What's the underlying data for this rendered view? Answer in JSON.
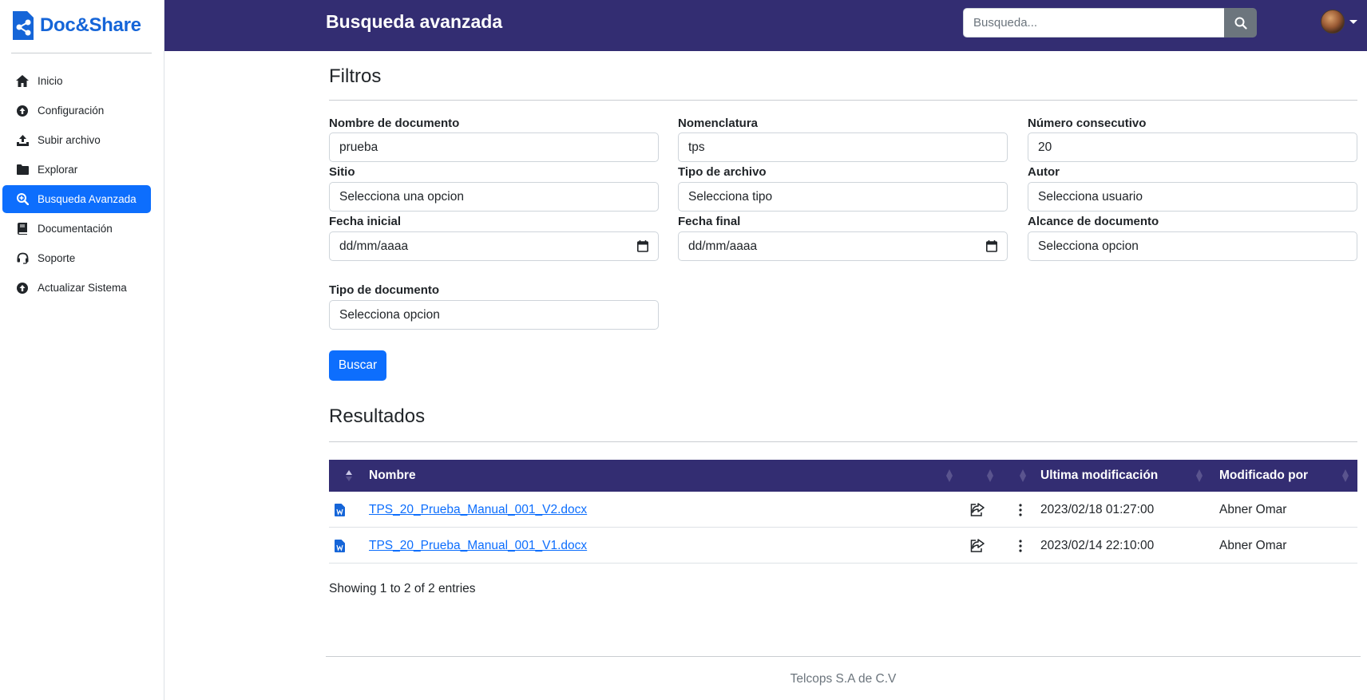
{
  "app": {
    "brand": "Doc&Share",
    "page_title": "Busqueda avanzada",
    "brand_color": "#1565d8",
    "header_color": "#332d72",
    "accent": "#0d6efd"
  },
  "search": {
    "placeholder": "Busqueda..."
  },
  "sidebar": {
    "items": [
      {
        "label": "Inicio",
        "icon": "home-icon"
      },
      {
        "label": "Configuración",
        "icon": "circle-arrow-up-icon"
      },
      {
        "label": "Subir archivo",
        "icon": "upload-icon"
      },
      {
        "label": "Explorar",
        "icon": "folder-icon"
      },
      {
        "label": "Busqueda Avanzada",
        "icon": "search-plus-icon",
        "active": true
      },
      {
        "label": "Documentación",
        "icon": "book-icon"
      },
      {
        "label": "Soporte",
        "icon": "headset-icon"
      },
      {
        "label": "Actualizar Sistema",
        "icon": "circle-arrow-up-icon"
      }
    ]
  },
  "filters": {
    "title": "Filtros",
    "nombre_documento": {
      "label": "Nombre de documento",
      "value": "prueba"
    },
    "nomenclatura": {
      "label": "Nomenclatura",
      "value": "tps"
    },
    "numero_consecutivo": {
      "label": "Número consecutivo",
      "value": "20"
    },
    "sitio": {
      "label": "Sitio",
      "value": "Selecciona una opcion"
    },
    "tipo_archivo": {
      "label": "Tipo de archivo",
      "value": "Selecciona tipo"
    },
    "autor": {
      "label": "Autor",
      "value": "Selecciona usuario"
    },
    "fecha_inicial": {
      "label": "Fecha inicial",
      "value": "dd/mm/aaaa"
    },
    "fecha_final": {
      "label": "Fecha final",
      "value": "dd/mm/aaaa"
    },
    "alcance": {
      "label": "Alcance de documento",
      "value": "Selecciona opcion"
    },
    "tipo_documento": {
      "label": "Tipo de documento",
      "value": "Selecciona opcion"
    },
    "buscar_label": "Buscar"
  },
  "results": {
    "title": "Resultados",
    "columns": {
      "nombre": "Nombre",
      "ultima_modificacion": "Ultima modificación",
      "modificado_por": "Modificado por"
    },
    "rows": [
      {
        "name": "TPS_20_Prueba_Manual_001_V2.docx",
        "modified": "2023/02/18 01:27:00",
        "modified_by": "Abner Omar"
      },
      {
        "name": "TPS_20_Prueba_Manual_001_V1.docx",
        "modified": "2023/02/14 22:10:00",
        "modified_by": "Abner Omar"
      }
    ],
    "showing": "Showing 1 to 2 of 2 entries"
  },
  "footer": {
    "text": "Telcops S.A de C.V"
  }
}
